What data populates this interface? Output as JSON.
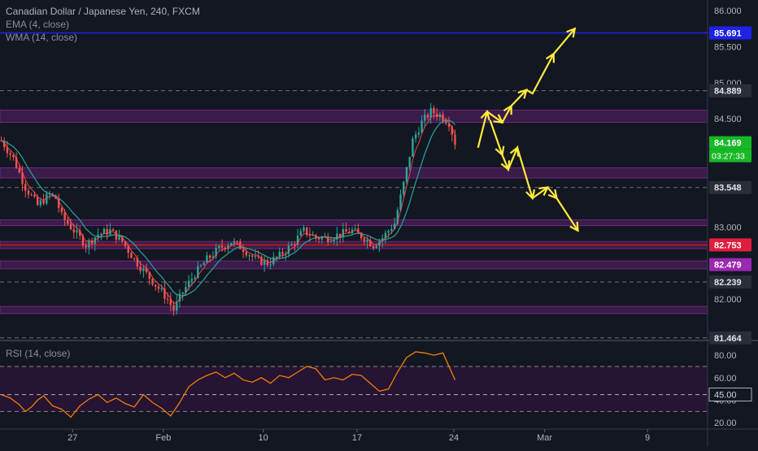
{
  "header": {
    "title": "Canadian Dollar / Japanese Yen, 240, FXCM",
    "indicators": [
      "EMA (4, close)",
      "WMA (14, close)"
    ]
  },
  "rsi": {
    "label": "RSI (14, close)"
  },
  "colors": {
    "background": "#131722",
    "candle_up": "#26a69a",
    "candle_down": "#ef5350",
    "ema": "#ff5252",
    "wma": "#26a69a",
    "zone": "#5b1f6b",
    "drawing": "#ffeb3b",
    "resistance_line": "#1e22e8",
    "rsi_line": "#f57c00"
  },
  "chart_data": [
    {
      "type": "candlestick",
      "title": "Canadian Dollar / Japanese Yen, 240, FXCM",
      "timeframe": "240",
      "y_range": [
        81.45,
        86.1
      ],
      "y_ticks": [
        {
          "value": 86.0,
          "label": "86.000"
        },
        {
          "value": 85.5,
          "label": "85.500"
        },
        {
          "value": 85.0,
          "label": "85.000"
        },
        {
          "value": 84.5,
          "label": "84.500"
        },
        {
          "value": 83.0,
          "label": "83.000"
        },
        {
          "value": 82.0,
          "label": "82.000"
        }
      ],
      "x_ticks": [
        "27",
        "Feb",
        "10",
        "17",
        "24",
        "Mar",
        "9"
      ],
      "price_labels": [
        {
          "value": 85.691,
          "text": "85.691",
          "bg": "#1e22e8",
          "fg": "#ffffff",
          "dashed": false
        },
        {
          "value": 84.889,
          "text": "84.889",
          "bg": "#2a2e39",
          "fg": "#e0e3eb",
          "dashed": true
        },
        {
          "value": 84.169,
          "text": "84.169",
          "bg": "#17b826",
          "fg": "#ffffff",
          "dashed": false
        },
        {
          "value": 83.548,
          "text": "83.548",
          "bg": "#2a2e39",
          "fg": "#e0e3eb",
          "dashed": true
        },
        {
          "value": 82.753,
          "text": "82.753",
          "bg": "#e01e3c",
          "fg": "#ffffff",
          "dashed": false
        },
        {
          "value": 82.479,
          "text": "82.479",
          "bg": "#9c27b0",
          "fg": "#ffffff",
          "dashed": false
        },
        {
          "value": 82.239,
          "text": "82.239",
          "bg": "#2a2e39",
          "fg": "#e0e3eb",
          "dashed": true
        },
        {
          "value": 81.464,
          "text": "81.464",
          "bg": "#2a2e39",
          "fg": "#e0e3eb",
          "dashed": true
        }
      ],
      "countdown": "03:27:33",
      "zones": [
        {
          "from": 84.45,
          "to": 84.62
        },
        {
          "from": 83.68,
          "to": 83.82
        },
        {
          "from": 83.02,
          "to": 83.1
        },
        {
          "from": 82.7,
          "to": 82.8
        },
        {
          "from": 82.42,
          "to": 82.53
        },
        {
          "from": 81.8,
          "to": 81.9
        }
      ],
      "close_path": [
        [
          0,
          84.2
        ],
        [
          4,
          83.95
        ],
        [
          8,
          83.55
        ],
        [
          12,
          83.3
        ],
        [
          16,
          83.45
        ],
        [
          18,
          83.4
        ],
        [
          20,
          83.15
        ],
        [
          24,
          82.95
        ],
        [
          28,
          82.75
        ],
        [
          32,
          82.9
        ],
        [
          36,
          82.95
        ],
        [
          40,
          82.8
        ],
        [
          44,
          82.55
        ],
        [
          48,
          82.35
        ],
        [
          52,
          82.15
        ],
        [
          55,
          82.0
        ],
        [
          57,
          81.85
        ],
        [
          60,
          82.1
        ],
        [
          64,
          82.35
        ],
        [
          68,
          82.55
        ],
        [
          72,
          82.7
        ],
        [
          76,
          82.8
        ],
        [
          80,
          82.7
        ],
        [
          84,
          82.55
        ],
        [
          88,
          82.5
        ],
        [
          92,
          82.6
        ],
        [
          96,
          82.75
        ],
        [
          100,
          82.95
        ],
        [
          104,
          82.85
        ],
        [
          108,
          82.85
        ],
        [
          112,
          82.9
        ],
        [
          116,
          82.95
        ],
        [
          120,
          82.85
        ],
        [
          123,
          82.75
        ],
        [
          126,
          82.85
        ],
        [
          130,
          83.05
        ],
        [
          133,
          83.6
        ],
        [
          136,
          84.2
        ],
        [
          139,
          84.45
        ],
        [
          142,
          84.6
        ],
        [
          145,
          84.55
        ],
        [
          148,
          84.45
        ],
        [
          150,
          84.17
        ]
      ],
      "projection_paths": [
        [
          [
            158,
            84.1
          ],
          [
            161,
            84.6
          ],
          [
            166,
            84.45
          ],
          [
            169,
            84.68
          ],
          [
            174,
            84.9
          ],
          [
            176,
            84.85
          ],
          [
            183,
            85.4
          ],
          [
            190,
            85.75
          ]
        ],
        [
          [
            162,
            84.48
          ],
          [
            166,
            84.0
          ],
          [
            168,
            83.8
          ],
          [
            171,
            84.1
          ],
          [
            176,
            83.4
          ],
          [
            181,
            83.55
          ],
          [
            184,
            83.4
          ],
          [
            191,
            82.95
          ]
        ]
      ]
    },
    {
      "type": "line",
      "title": "RSI (14, close)",
      "y_range": [
        18,
        88
      ],
      "y_ticks": [
        {
          "value": 80,
          "label": "80.00"
        },
        {
          "value": 60,
          "label": "60.00"
        },
        {
          "value": 40,
          "label": "40.00"
        },
        {
          "value": 20,
          "label": "20.00"
        }
      ],
      "band": [
        30,
        70
      ],
      "level_label": {
        "value": 45,
        "text": "45.00"
      },
      "values": [
        [
          0,
          45
        ],
        [
          3,
          42
        ],
        [
          6,
          36
        ],
        [
          8,
          30
        ],
        [
          10,
          34
        ],
        [
          12,
          40
        ],
        [
          14,
          44
        ],
        [
          17,
          35
        ],
        [
          20,
          32
        ],
        [
          23,
          25
        ],
        [
          26,
          35
        ],
        [
          29,
          41
        ],
        [
          32,
          45
        ],
        [
          35,
          38
        ],
        [
          38,
          42
        ],
        [
          41,
          37
        ],
        [
          44,
          34
        ],
        [
          47,
          45
        ],
        [
          50,
          38
        ],
        [
          53,
          33
        ],
        [
          56,
          26
        ],
        [
          59,
          38
        ],
        [
          62,
          52
        ],
        [
          65,
          58
        ],
        [
          68,
          62
        ],
        [
          71,
          65
        ],
        [
          74,
          60
        ],
        [
          77,
          64
        ],
        [
          80,
          58
        ],
        [
          83,
          56
        ],
        [
          86,
          60
        ],
        [
          89,
          55
        ],
        [
          92,
          62
        ],
        [
          95,
          60
        ],
        [
          98,
          65
        ],
        [
          101,
          70
        ],
        [
          104,
          68
        ],
        [
          107,
          58
        ],
        [
          110,
          60
        ],
        [
          113,
          58
        ],
        [
          116,
          63
        ],
        [
          119,
          62
        ],
        [
          122,
          55
        ],
        [
          125,
          48
        ],
        [
          128,
          50
        ],
        [
          131,
          65
        ],
        [
          134,
          78
        ],
        [
          137,
          83
        ],
        [
          140,
          82
        ],
        [
          143,
          80
        ],
        [
          146,
          82
        ],
        [
          148,
          70
        ],
        [
          150,
          58
        ]
      ]
    }
  ]
}
